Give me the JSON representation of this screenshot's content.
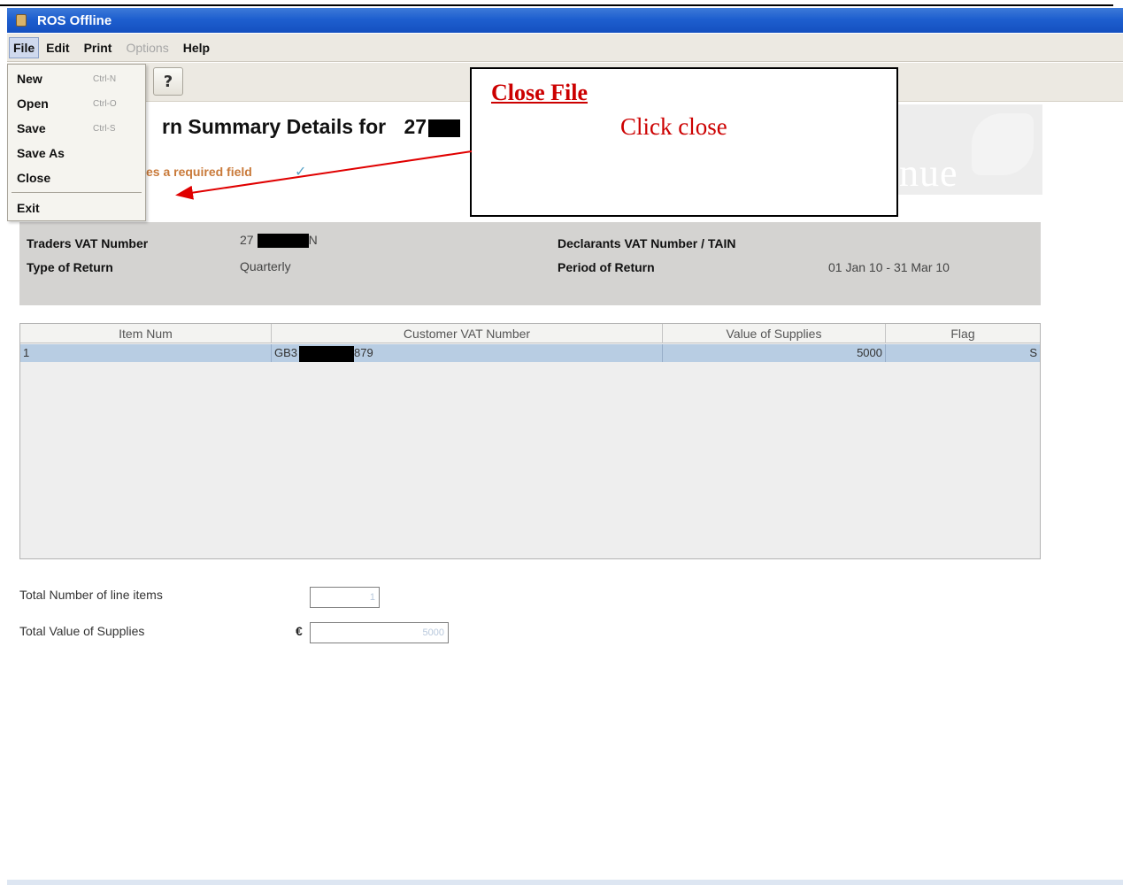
{
  "window": {
    "title": "ROS Offline"
  },
  "menubar": {
    "file": "File",
    "edit": "Edit",
    "print": "Print",
    "options": "Options",
    "help": "Help"
  },
  "file_menu": {
    "items": [
      {
        "label": "New",
        "shortcut": "Ctrl-N"
      },
      {
        "label": "Open",
        "shortcut": "Ctrl-O"
      },
      {
        "label": "Save",
        "shortcut": "Ctrl-S"
      },
      {
        "label": "Save As",
        "shortcut": ""
      },
      {
        "label": "Close",
        "shortcut": ""
      },
      {
        "label": "Exit",
        "shortcut": ""
      }
    ]
  },
  "toolbar": {
    "help_icon": "help-icon"
  },
  "header": {
    "title": "rn Summary Details for",
    "vat_prefix": "27",
    "required_note": "es a required field",
    "brand": "nue"
  },
  "details": {
    "traders_vat_label": "Traders VAT Number",
    "traders_vat_prefix": "27",
    "traders_vat_suffix": "N",
    "type_label": "Type of Return",
    "type_value": "Quarterly",
    "declarants_label": "Declarants VAT Number / TAIN",
    "period_label": "Period of Return",
    "period_value": "01 Jan 10 - 31 Mar 10"
  },
  "table": {
    "columns": [
      "Item Num",
      "Customer VAT Number",
      "Value of Supplies",
      "Flag"
    ],
    "rows": [
      {
        "item": "1",
        "vat_prefix": "GB3",
        "vat_suffix": "879",
        "value": "5000",
        "flag": "S"
      }
    ]
  },
  "totals": {
    "line_items_label": "Total Number of line items",
    "line_items_value": "1",
    "value_label": "Total Value of Supplies",
    "currency": "€",
    "value_value": "5000"
  },
  "callout": {
    "title": "Close File",
    "text": "Click close"
  },
  "colors": {
    "titlebar": "#1e5fcf",
    "annotation": "#cc0000",
    "selected_row": "#b8cde3",
    "details_panel": "#d4d3d1"
  }
}
